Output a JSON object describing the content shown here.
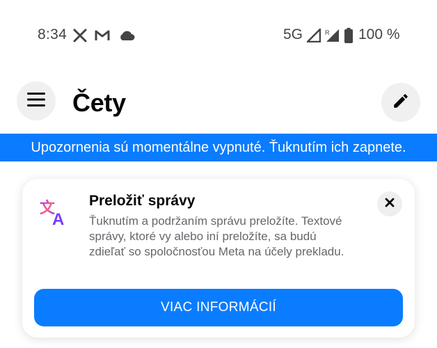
{
  "status_bar": {
    "time": "8:34",
    "left_icons": [
      "x-icon",
      "gmail-icon",
      "cloud-icon"
    ],
    "network": "5G",
    "battery": "100 %",
    "battery_level": 1.0
  },
  "header": {
    "title": "Čety",
    "menu_icon": "hamburger-menu-icon",
    "compose_icon": "pencil-icon"
  },
  "notification_banner": {
    "text": "Upozornenia sú momentálne vypnuté. Ťuknutím ich zapnete."
  },
  "translate_card": {
    "title": "Preložiť správy",
    "body": "Ťuknutím a podržaním správu preložíte. Textové správy, ktoré vy alebo iní preložíte, sa budú zdieľať so spoločnosťou Meta na účely prekladu.",
    "button_label": "VIAC INFORMÁCIÍ",
    "icon": "translate-icon",
    "close_icon": "close-icon"
  },
  "colors": {
    "accent": "#0a7cff",
    "title_text": "#050505",
    "secondary_text": "#65676b",
    "button_bg": "#f0f0f0"
  }
}
